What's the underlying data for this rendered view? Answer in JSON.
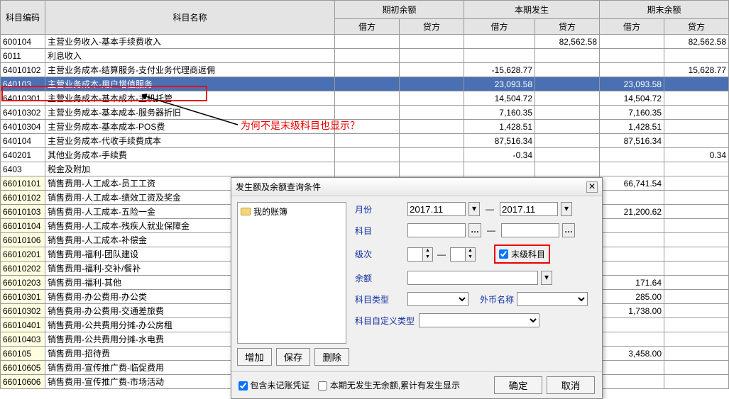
{
  "headers": {
    "code": "科目编码",
    "name": "科目名称",
    "begin": "期初余额",
    "occur": "本期发生",
    "end": "期末余额",
    "debit": "借方",
    "credit": "贷方"
  },
  "rows": [
    {
      "code": "600104",
      "name": "    主营业务收入-基本手续费收入",
      "c2": "82,562.58",
      "c3": "82,562.58"
    },
    {
      "code": "6011",
      "name": "利息收入"
    },
    {
      "code": "64010102",
      "name": "        主营业务成本-结算服务-支付业务代理商返佣",
      "d2": "-15,628.77",
      "c3": "15,628.77"
    },
    {
      "code": "640103",
      "name": "    主营业务成本-用户增值服务",
      "d2": "23,093.58",
      "d3": "23,093.58",
      "sel": true,
      "boxed": true
    },
    {
      "code": "64010301",
      "name": "        主营业务成本-基本成本-主机托管",
      "d2": "14,504.72",
      "d3": "14,504.72"
    },
    {
      "code": "64010302",
      "name": "        主营业务成本-基本成本-服务器折旧",
      "d2": "7,160.35",
      "d3": "7,160.35"
    },
    {
      "code": "64010304",
      "name": "        主营业务成本-基本成本-POS费",
      "d2": "1,428.51",
      "d3": "1,428.51"
    },
    {
      "code": "640104",
      "name": "    主营业务成本-代收手续费成本",
      "d2": "87,516.34",
      "d3": "87,516.34"
    },
    {
      "code": "640201",
      "name": "    其他业务成本-手续费",
      "d2": "-0.34",
      "c3": "0.34"
    },
    {
      "code": "6403",
      "name": "税金及附加"
    },
    {
      "code": "66010101",
      "name": "        销售费用-人工成本-员工工资",
      "d3": "66,741.54",
      "y": true
    },
    {
      "code": "66010102",
      "name": "        销售费用-人工成本-绩效工资及奖金",
      "y": true
    },
    {
      "code": "66010103",
      "name": "        销售费用-人工成本-五险一金",
      "d3": "21,200.62",
      "y": true
    },
    {
      "code": "66010104",
      "name": "        销售费用-人工成本-残疾人就业保障金",
      "y": true
    },
    {
      "code": "66010106",
      "name": "        销售费用-人工成本-补偿金",
      "y": true
    },
    {
      "code": "66010201",
      "name": "        销售费用-福利-团队建设",
      "y": true
    },
    {
      "code": "66010202",
      "name": "        销售费用-福利-交补/餐补",
      "y": true
    },
    {
      "code": "66010203",
      "name": "        销售费用-福利-其他",
      "d3": "171.64",
      "y": true
    },
    {
      "code": "66010301",
      "name": "        销售费用-办公费用-办公类",
      "d3": "285.00",
      "y": true
    },
    {
      "code": "66010302",
      "name": "        销售费用-办公费用-交通差旅费",
      "d3": "1,738.00",
      "y": true
    },
    {
      "code": "66010401",
      "name": "        销售费用-公共费用分摊-办公房租",
      "y": true
    },
    {
      "code": "66010403",
      "name": "        销售费用-公共费用分摊-水电费",
      "y": true
    },
    {
      "code": "660105",
      "name": "    销售费用-招待费",
      "d3": "3,458.00",
      "y": true
    },
    {
      "code": "66010605",
      "name": "        销售费用-宣传推广费-临促费用",
      "y": true
    },
    {
      "code": "66010606",
      "name": "        销售费用-宣传推广费-市场活动",
      "y": true
    }
  ],
  "anno": "为何不是末级科目也显示？",
  "dlg": {
    "title": "发生额及余额查询条件",
    "tree": "我的账簿",
    "month": "月份",
    "dfrom": "2017.11",
    "to": "—",
    "dto": "2017.11",
    "subject": "科目",
    "level": "级次",
    "leaf": "末级科目",
    "balance": "余额",
    "stype": "科目类型",
    "curr": "外币名称",
    "custom": "科目自定义类型",
    "add": "增加",
    "save": "保存",
    "del": "删除",
    "chk1": "包含未记账凭证",
    "chk2": "本期无发生无余额,累计有发生显示",
    "ok": "确定",
    "cancel": "取消"
  }
}
